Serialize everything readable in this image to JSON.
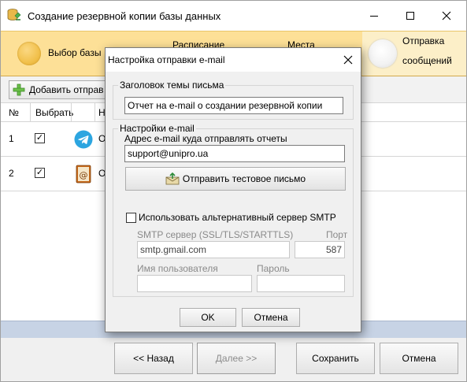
{
  "window": {
    "title": "Создание резервной копии базы данных"
  },
  "steps": [
    {
      "label": "Выбор базы"
    },
    {
      "label": "Расписание"
    },
    {
      "label": "Места"
    },
    {
      "label": "Отправка",
      "label2": "сообщений",
      "active": true
    }
  ],
  "toolbar": {
    "add_label": "Добавить отправ"
  },
  "grid": {
    "headers": [
      "№",
      "Выбрать",
      "Н"
    ],
    "rows": [
      {
        "num": "1",
        "checked": "✓",
        "icon": "telegram-icon",
        "text": "О"
      },
      {
        "num": "2",
        "checked": "✓",
        "icon": "email-book-icon",
        "text": "О"
      }
    ]
  },
  "bottombar": {
    "back": "<< Назад",
    "next": "Далее >>",
    "save": "Сохранить",
    "cancel": "Отмена"
  },
  "dialog": {
    "title": "Настройка отправки e-mail",
    "subject_group": "Заголовок темы письма",
    "subject_value": "Отчет на e-mail о создании резервной копии",
    "settings_group": "Настройки e-mail",
    "address_label": "Адрес e-mail куда отправлять отчеты",
    "address_value": "support@unipro.ua",
    "send_test": "Отправить тестовое письмо",
    "alt_server_label": "Использовать альтернативный сервер SMTP",
    "smtp_label": "SMTP сервер  (SSL/TLS/STARTTLS)",
    "port_label": "Порт",
    "smtp_value": "smtp.gmail.com",
    "port_value": "587",
    "user_label": "Имя пользователя",
    "password_label": "Пароль",
    "user_value": "",
    "password_value": "",
    "ok": "OK",
    "cancel": "Отмена"
  },
  "colors": {
    "steps_bg": "#fde097",
    "grid_footer": "#c7d3e5",
    "telegram": "#2ca5e0"
  }
}
